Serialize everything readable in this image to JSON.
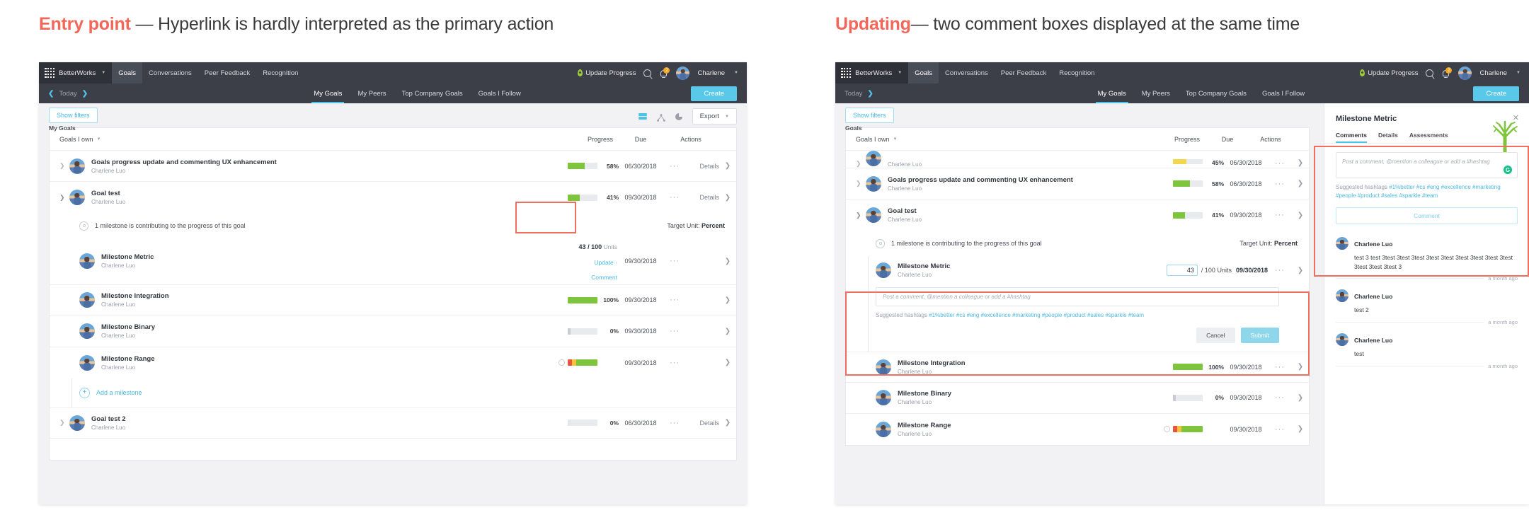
{
  "captions": {
    "left": {
      "accent": "Entry point",
      "rest": " — Hyperlink is hardly interpreted as the primary action"
    },
    "right": {
      "accent": "Updating",
      "rest": "— two comment boxes displayed at the same time"
    }
  },
  "colors": {
    "accent_red": "#ee6f5f",
    "nav_dark": "#3c3f47",
    "brand_cyan": "#4ec3e8",
    "progress_green": "#7ec43c",
    "progress_yellow": "#f2d64b",
    "link_blue": "#4cb8e0"
  },
  "nav": {
    "brand": "BetterWorks",
    "items": [
      "Goals",
      "Conversations",
      "Peer Feedback",
      "Recognition"
    ],
    "active_item": "Goals",
    "update_progress": "Update Progress",
    "notification_count": "2",
    "user": "Charlene"
  },
  "subnav": {
    "today": "Today",
    "tabs": [
      "My Goals",
      "My Peers",
      "Top Company Goals",
      "Goals I Follow"
    ],
    "active_tab": "My Goals",
    "create": "Create"
  },
  "toolbar": {
    "show_filters": "Show filters",
    "export": "Export",
    "breadcrumb_left": "My Goals",
    "breadcrumb_right": "Goals"
  },
  "table": {
    "owner_filter": "Goals I own",
    "col_progress": "Progress",
    "col_due": "Due",
    "col_actions": "Actions",
    "details_label": "Details"
  },
  "left_panel": {
    "goals": [
      {
        "title": "Goals progress update and commenting UX enhancement",
        "owner": "Charlene Luo",
        "progress_pct": 58,
        "progress_label": "58%",
        "due": "06/30/2018",
        "expanded": false
      },
      {
        "title": "Goal test",
        "owner": "Charlene Luo",
        "progress_pct": 41,
        "progress_label": "41%",
        "due": "09/30/2018",
        "expanded": true
      }
    ],
    "milestone_note": "1 milestone is contributing to the progress of this goal",
    "target_unit_label": "Target Unit:",
    "target_unit_value": "Percent",
    "milestones": [
      {
        "title": "Milestone Metric",
        "owner": "Charlene Luo",
        "type": "metric",
        "value": "43",
        "divider": "/ 100",
        "units": "Units",
        "update_link": "Update",
        "dot": "·",
        "comment_link": "Comment",
        "due": "09/30/2018",
        "highlighted": true
      },
      {
        "title": "Milestone Integration",
        "owner": "Charlene Luo",
        "type": "bar",
        "progress_pct": 100,
        "progress_label": "100%",
        "due": "09/30/2018"
      },
      {
        "title": "Milestone Binary",
        "owner": "Charlene Luo",
        "type": "bar",
        "progress_pct": 4,
        "progress_label": "0%",
        "due": "09/30/2018"
      },
      {
        "title": "Milestone Range",
        "owner": "Charlene Luo",
        "type": "range",
        "progress_label": "",
        "due": "09/30/2018"
      }
    ],
    "add_milestone": "Add a milestone",
    "bottom_goal": {
      "title": "Goal test 2",
      "owner": "Charlene Luo",
      "progress_pct": 4,
      "progress_label": "0%",
      "due": "06/30/2018"
    }
  },
  "right_panel": {
    "partial_row": {
      "owner": "Charlene Luo",
      "progress_pct": 45,
      "progress_label": "45%",
      "due": "06/30/2018"
    },
    "goals": [
      {
        "title": "Goals progress update and commenting UX enhancement",
        "owner": "Charlene Luo",
        "progress_pct": 58,
        "progress_label": "58%",
        "due": "06/30/2018",
        "expanded": false
      },
      {
        "title": "Goal test",
        "owner": "Charlene Luo",
        "progress_pct": 41,
        "progress_label": "41%",
        "due": "09/30/2018",
        "expanded": true
      }
    ],
    "milestone_note": "1 milestone is contributing to the progress of this goal",
    "target_unit_label": "Target Unit:",
    "target_unit_value": "Percent",
    "inline_composer": {
      "title": "Milestone Metric",
      "owner": "Charlene Luo",
      "value": "43",
      "units": "/ 100 Units",
      "due": "09/30/2018",
      "placeholder": "Post a comment, @mention a colleague or add a #hashtag",
      "suggested_label": "Suggested hashtags",
      "hashtags": [
        "#1%better",
        "#cs",
        "#eng",
        "#excellence",
        "#marketing",
        "#people",
        "#product",
        "#sales",
        "#sparkle",
        "#team"
      ],
      "cancel": "Cancel",
      "submit": "Submit"
    },
    "milestones_below": [
      {
        "title": "Milestone Integration",
        "owner": "Charlene Luo",
        "type": "bar",
        "progress_pct": 100,
        "progress_label": "100%",
        "due": "09/30/2018"
      },
      {
        "title": "Milestone Binary",
        "owner": "Charlene Luo",
        "type": "bar",
        "progress_pct": 4,
        "progress_label": "0%",
        "due": "09/30/2018"
      },
      {
        "title": "Milestone Range",
        "owner": "Charlene Luo",
        "type": "range",
        "progress_label": "",
        "due": "09/30/2018"
      }
    ],
    "detail": {
      "title": "Milestone Metric",
      "tabs": [
        "Comments",
        "Details",
        "Assessments"
      ],
      "active_tab": "Comments",
      "composer_placeholder": "Post a comment, @mention a colleague or add a #hashtag",
      "grammar_badge": "G",
      "suggested_label": "Suggested hashtags",
      "hashtags": [
        "#1%better",
        "#cs",
        "#eng",
        "#excellence",
        "#marketing",
        "#people",
        "#product",
        "#sales",
        "#sparkle",
        "#team"
      ],
      "comment_button": "Comment",
      "comments": [
        {
          "author": "Charlene Luo",
          "text": "test 3 test 3test 3test 3test 3test 3test 3test 3test 3test 3test 3test 3test 3test 3",
          "time": "a month ago"
        },
        {
          "author": "Charlene Luo",
          "text": "test 2",
          "time": "a month ago"
        },
        {
          "author": "Charlene Luo",
          "text": "test",
          "time": "a month ago"
        }
      ]
    }
  }
}
